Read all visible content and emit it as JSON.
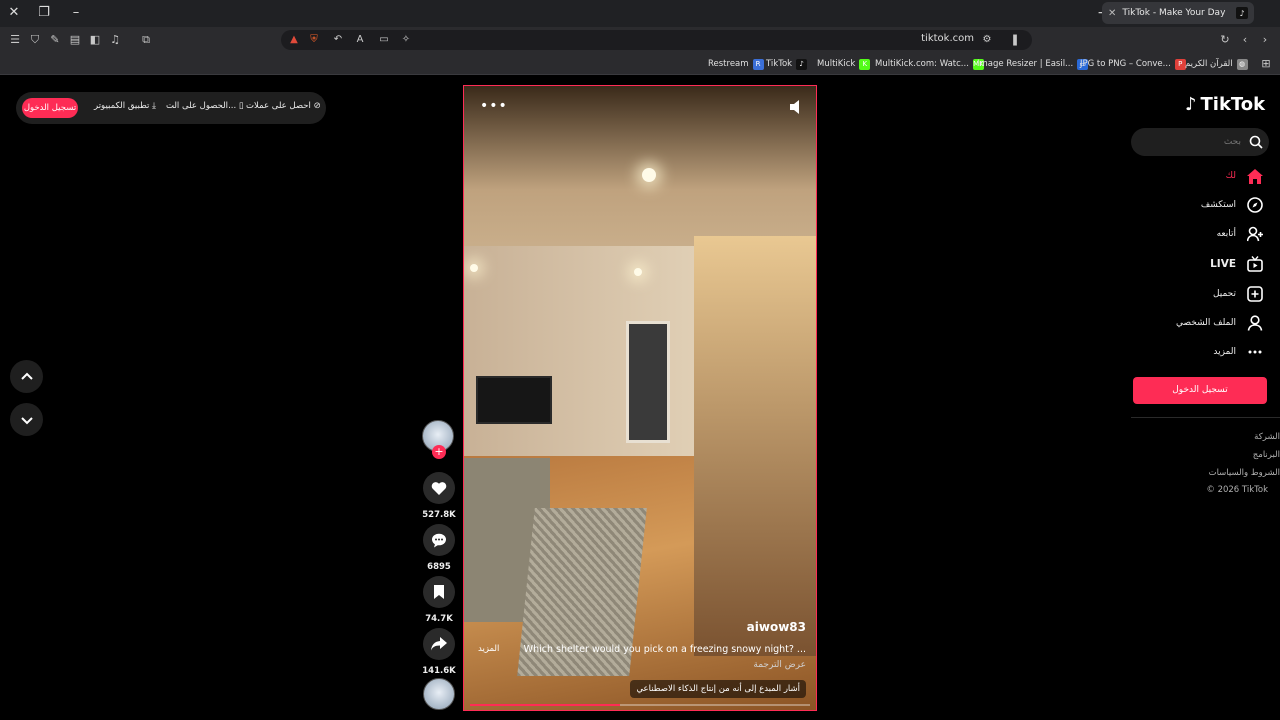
{
  "browser": {
    "tab_title": "TikTok - Make Your Day",
    "url": "tiktok.com",
    "bookmarks": [
      {
        "label": "Restream",
        "icon_char": "R",
        "color": "#3b6fd8"
      },
      {
        "label": "TikTok",
        "icon_char": "♪",
        "color": "#111111"
      },
      {
        "label": "MultiKick",
        "icon_char": "K",
        "color": "#53fc18"
      },
      {
        "label": "MultiKick.com: Watc...",
        "icon_char": "MK",
        "color": "#53fc18"
      },
      {
        "label": "Image Resizer | Easil...",
        "icon_char": "▭",
        "color": "#2a6ad8"
      },
      {
        "label": "JPG to PNG – Conve...",
        "icon_char": "P",
        "color": "#e0403a"
      },
      {
        "label": "القرآن الكريم",
        "icon_char": "◍",
        "color": "#888888"
      }
    ]
  },
  "top_pill": {
    "login": "تسجيل الدخول",
    "desktop_app": "تطبيق الكمبيوتر",
    "get_app": "الحصول على الت...",
    "get_coins": "احصل على عملات"
  },
  "video": {
    "username": "aiwow83",
    "caption": "Which shelter would you pick on a freezing snowy night? ...",
    "more": "المزيد",
    "translate": "عرض الترجمة",
    "ai_label": "أشار المبدع إلى أنه من إنتاج الذكاء الاصطناعي",
    "progress": 0.44
  },
  "actions": {
    "likes": "527.8K",
    "comments": "6895",
    "saves": "74.7K",
    "shares": "141.6K"
  },
  "sidebar": {
    "logo": "TikTok",
    "search_placeholder": "بحث",
    "nav": [
      {
        "label": "لك",
        "icon": "home-icon"
      },
      {
        "label": "استكشف",
        "icon": "compass-icon"
      },
      {
        "label": "أتابعه",
        "icon": "following-icon"
      },
      {
        "label": "LIVE",
        "icon": "live-icon"
      },
      {
        "label": "تحميل",
        "icon": "upload-icon"
      },
      {
        "label": "الملف الشخصي",
        "icon": "profile-icon"
      },
      {
        "label": "المزيد",
        "icon": "more-icon"
      }
    ],
    "login_button": "تسجيل الدخول",
    "footer": [
      "الشركة",
      "البرنامج",
      "الشروط والسياسات",
      "© 2026 TikTok"
    ]
  },
  "colors": {
    "accent": "#fe2c55"
  }
}
